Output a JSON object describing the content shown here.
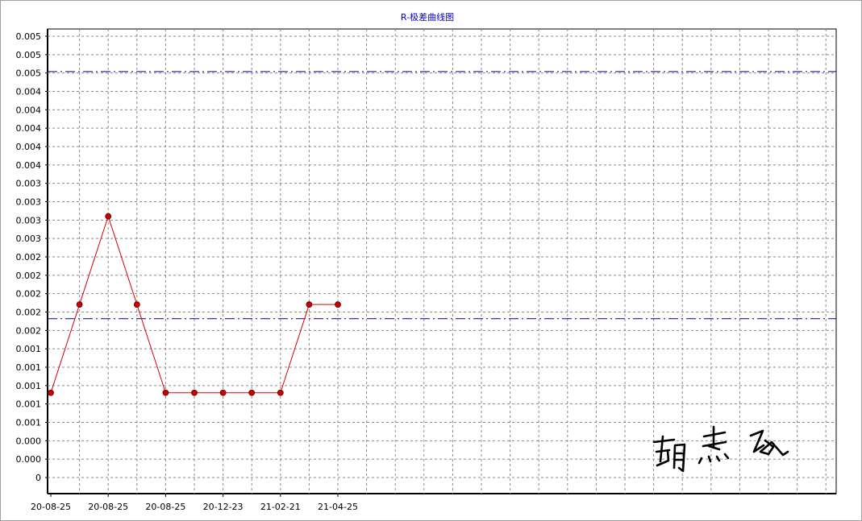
{
  "chart_data": {
    "type": "line",
    "title": "R-极差曲线图",
    "xlabel": "",
    "ylabel": "",
    "ylim": [
      0,
      0.005
    ],
    "y_tick_labels": [
      "0",
      "0.000",
      "0.000",
      "0.001",
      "0.001",
      "0.001",
      "0.001",
      "0.001",
      "0.002",
      "0.002",
      "0.002",
      "0.002",
      "0.002",
      "0.003",
      "0.003",
      "0.003",
      "0.003",
      "0.004",
      "0.004",
      "0.004",
      "0.004",
      "0.004",
      "0.005",
      "0.005",
      "0.005"
    ],
    "x_tick_labels": [
      "20-08-25",
      "20-08-25",
      "20-08-25",
      "20-12-23",
      "21-02-21",
      "21-04-25"
    ],
    "grid": true,
    "series": [
      {
        "values": [
          0.00096,
          0.00196,
          0.00296,
          0.00196,
          0.00096,
          0.00096,
          0.00096,
          0.00096,
          0.00096,
          0.00196,
          0.00196
        ],
        "color": "#dd0000",
        "marker_color": "#cc0000"
      }
    ],
    "control_limits": [
      {
        "value": 0.0046,
        "color": "#000099",
        "style": "dash-dot"
      },
      {
        "value": 0.0018,
        "color": "#000099",
        "style": "dash-dot"
      }
    ],
    "signature": "胡杰红"
  }
}
